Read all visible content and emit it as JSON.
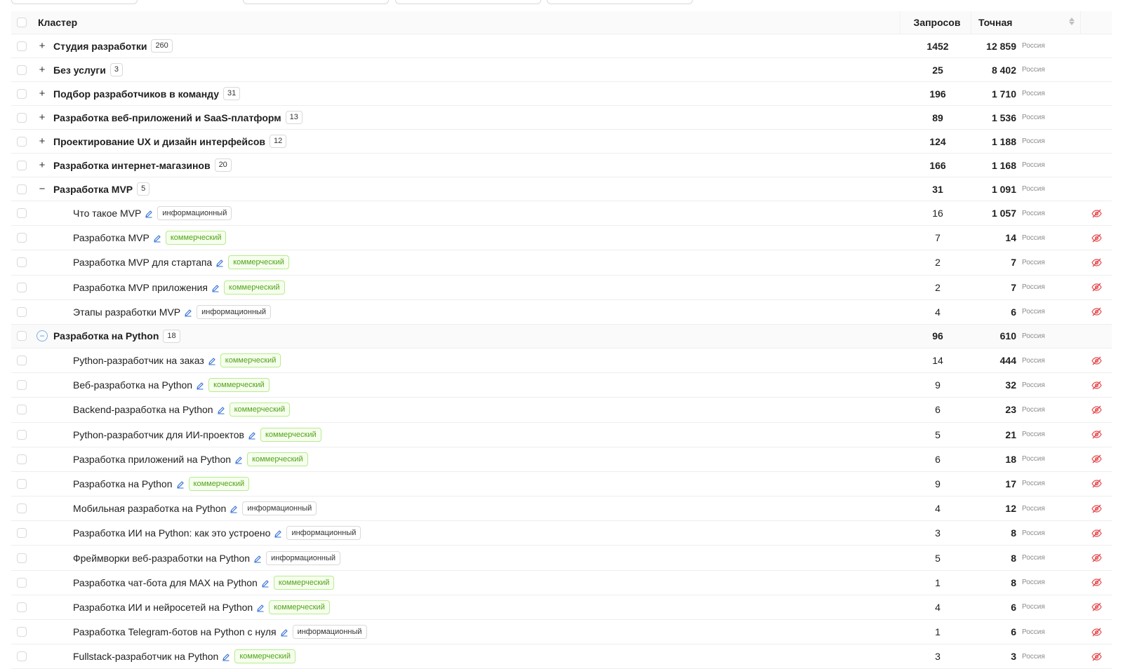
{
  "header": {
    "cluster": "Кластер",
    "requests": "Запросов",
    "exact": "Точная"
  },
  "groups": [
    {
      "name": "Студия разработки",
      "count": "260",
      "requests": "1452",
      "exact": "12 859",
      "region": "Россия",
      "toggle": "+"
    },
    {
      "name": "Без услуги",
      "count": "3",
      "requests": "25",
      "exact": "8 402",
      "region": "Россия",
      "toggle": "+"
    },
    {
      "name": "Подбор разработчиков в команду",
      "count": "31",
      "requests": "196",
      "exact": "1 710",
      "region": "Россия",
      "toggle": "+"
    },
    {
      "name": "Разработка веб-приложений и SaaS-платформ",
      "count": "13",
      "requests": "89",
      "exact": "1 536",
      "region": "Россия",
      "toggle": "+"
    },
    {
      "name": "Проектирование UX и дизайн интерфейсов",
      "count": "12",
      "requests": "124",
      "exact": "1 188",
      "region": "Россия",
      "toggle": "+"
    },
    {
      "name": "Разработка интернет-магазинов",
      "count": "20",
      "requests": "166",
      "exact": "1 168",
      "region": "Россия",
      "toggle": "+"
    },
    {
      "name": "Разработка MVP",
      "count": "5",
      "requests": "31",
      "exact": "1 091",
      "region": "Россия",
      "toggle": "−",
      "keywords": [
        {
          "text": "Что такое MVP",
          "tag": "информационный",
          "type": "info",
          "requests": "16",
          "exact": "1 057",
          "region": "Россия"
        },
        {
          "text": "Разработка MVP",
          "tag": "коммерческий",
          "type": "comm",
          "requests": "7",
          "exact": "14",
          "region": "Россия"
        },
        {
          "text": "Разработка MVP для стартапа",
          "tag": "коммерческий",
          "type": "comm",
          "requests": "2",
          "exact": "7",
          "region": "Россия"
        },
        {
          "text": "Разработка MVP приложения",
          "tag": "коммерческий",
          "type": "comm",
          "requests": "2",
          "exact": "7",
          "region": "Россия"
        },
        {
          "text": "Этапы разработки MVP",
          "tag": "информационный",
          "type": "info",
          "requests": "4",
          "exact": "6",
          "region": "Россия"
        }
      ]
    },
    {
      "name": "Разработка на Python",
      "count": "18",
      "requests": "96",
      "exact": "610",
      "region": "Россия",
      "toggle": "−",
      "circle": true,
      "keywords": [
        {
          "text": "Python-разработчик на заказ",
          "tag": "коммерческий",
          "type": "comm",
          "requests": "14",
          "exact": "444",
          "region": "Россия"
        },
        {
          "text": "Веб-разработка на Python",
          "tag": "коммерческий",
          "type": "comm",
          "requests": "9",
          "exact": "32",
          "region": "Россия"
        },
        {
          "text": "Backend-разработка на Python",
          "tag": "коммерческий",
          "type": "comm",
          "requests": "6",
          "exact": "23",
          "region": "Россия"
        },
        {
          "text": "Python-разработчик для ИИ-проектов",
          "tag": "коммерческий",
          "type": "comm",
          "requests": "5",
          "exact": "21",
          "region": "Россия"
        },
        {
          "text": "Разработка приложений на Python",
          "tag": "коммерческий",
          "type": "comm",
          "requests": "6",
          "exact": "18",
          "region": "Россия"
        },
        {
          "text": "Разработка на Python",
          "tag": "коммерческий",
          "type": "comm",
          "requests": "9",
          "exact": "17",
          "region": "Россия"
        },
        {
          "text": "Мобильная разработка на Python",
          "tag": "информационный",
          "type": "info",
          "requests": "4",
          "exact": "12",
          "region": "Россия"
        },
        {
          "text": "Разработка ИИ на Python: как это устроено",
          "tag": "информационный",
          "type": "info",
          "requests": "3",
          "exact": "8",
          "region": "Россия"
        },
        {
          "text": "Фреймворки веб-разработки на Python",
          "tag": "информационный",
          "type": "info",
          "requests": "5",
          "exact": "8",
          "region": "Россия"
        },
        {
          "text": "Разработка чат-бота для MAX на Python",
          "tag": "коммерческий",
          "type": "comm",
          "requests": "1",
          "exact": "8",
          "region": "Россия"
        },
        {
          "text": "Разработка ИИ и нейросетей на Python",
          "tag": "коммерческий",
          "type": "comm",
          "requests": "4",
          "exact": "6",
          "region": "Россия"
        },
        {
          "text": "Разработка Telegram-ботов на Python с нуля",
          "tag": "информационный",
          "type": "info",
          "requests": "1",
          "exact": "6",
          "region": "Россия"
        },
        {
          "text": "Fullstack-разработчик на Python",
          "tag": "коммерческий",
          "type": "comm",
          "requests": "3",
          "exact": "3",
          "region": "Россия"
        }
      ]
    }
  ],
  "colors": {
    "accent": "#2f6fd6",
    "hide_icon": "#e5484d",
    "commercial_tag": "#52a31a",
    "border": "#eeeeee"
  },
  "icons": {
    "edit": "pencil-icon",
    "hide": "eye-off-icon"
  }
}
